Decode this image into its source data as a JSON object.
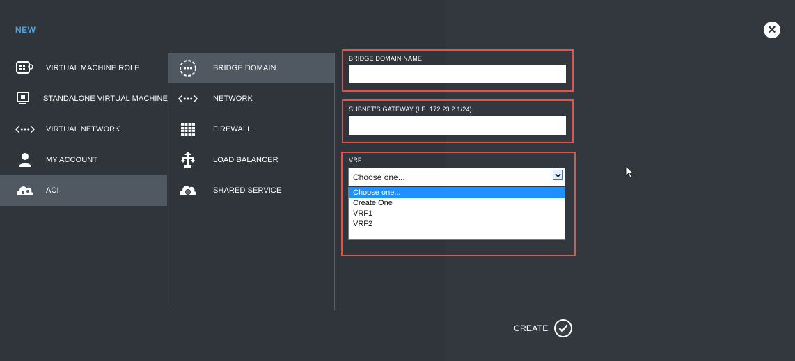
{
  "header": {
    "title": "NEW",
    "close_glyph": "✕",
    "close_icon": "close-icon"
  },
  "column1": {
    "items": [
      {
        "label": "VIRTUAL MACHINE ROLE",
        "icon": "vm-role-icon",
        "active": false
      },
      {
        "label": "STANDALONE VIRTUAL MACHINE",
        "icon": "standalone-vm-icon",
        "active": false
      },
      {
        "label": "VIRTUAL NETWORK",
        "icon": "virtual-network-icon",
        "active": false
      },
      {
        "label": "MY ACCOUNT",
        "icon": "user-icon",
        "active": false
      },
      {
        "label": "ACI",
        "icon": "cloud-gear-icon",
        "active": true
      }
    ]
  },
  "column2": {
    "items": [
      {
        "label": "BRIDGE DOMAIN",
        "icon": "bridge-domain-icon",
        "active": true
      },
      {
        "label": "NETWORK",
        "icon": "network-icon",
        "active": false
      },
      {
        "label": "FIREWALL",
        "icon": "firewall-icon",
        "active": false
      },
      {
        "label": "LOAD BALANCER",
        "icon": "load-balancer-icon",
        "active": false
      },
      {
        "label": "SHARED SERVICE",
        "icon": "shared-service-icon",
        "active": false
      }
    ]
  },
  "form": {
    "bridge_domain_name": {
      "label": "BRIDGE DOMAIN NAME",
      "value": ""
    },
    "subnet_gateway": {
      "label": "SUBNET'S GATEWAY (I.E. 172.23.2.1/24)",
      "value": ""
    },
    "vrf": {
      "label": "VRF",
      "selected": "Choose one...",
      "options": [
        "Choose one...",
        "Create One",
        "VRF1",
        "VRF2"
      ],
      "highlighted_index": 0
    },
    "highlight_color": "#e0544a"
  },
  "footer": {
    "create_label": "CREATE",
    "create_icon": "checkmark-icon"
  },
  "colors": {
    "accent": "#4aa3df",
    "active_bg": "#505861",
    "background": "#30353c"
  }
}
